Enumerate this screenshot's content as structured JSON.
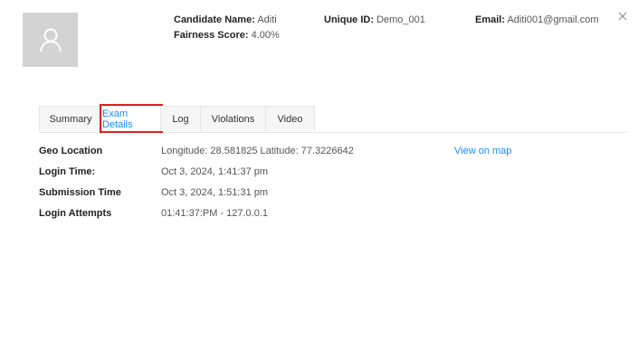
{
  "candidate": {
    "name_label": "Candidate Name:",
    "name_value": "Aditi",
    "fairness_label": "Fairness Score:",
    "fairness_value": "4.00%",
    "uid_label": "Unique ID:",
    "uid_value": "Demo_001",
    "email_label": "Email:",
    "email_value": "Aditi001@gmail.com"
  },
  "tabs": [
    {
      "label": "Summary",
      "active": false
    },
    {
      "label": "Exam Details",
      "active": true
    },
    {
      "label": "Log",
      "active": false
    },
    {
      "label": "Violations",
      "active": false
    },
    {
      "label": "Video",
      "active": false
    }
  ],
  "details": [
    {
      "label": "Geo Location",
      "value": "Longitude: 28.581825 Latitude: 77.3226642"
    },
    {
      "label": "Login Time:",
      "value": "Oct 3, 2024, 1:41:37 pm"
    },
    {
      "label": "Submission Time",
      "value": "Oct 3, 2024, 1:51:31 pm"
    },
    {
      "label": "Login Attempts",
      "value": "01:41:37:PM - 127.0.0.1"
    }
  ],
  "map_link": "View on map",
  "colors": {
    "accent": "#1a8cff",
    "highlight": "#e02020",
    "avatar_bg": "#d3d3d3"
  },
  "icons": {
    "avatar": "user-icon",
    "close": "close-icon"
  }
}
